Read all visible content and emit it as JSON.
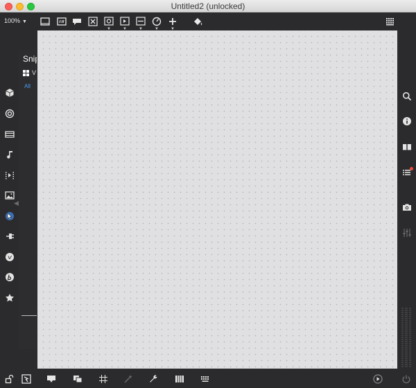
{
  "window": {
    "title": "Untitled2 (unlocked)"
  },
  "toolbar": {
    "zoom_label": "100%",
    "zoom_caret": "▼",
    "icons": [
      "panel-icon",
      "comment-icon",
      "speech-bubble-icon",
      "close-box-icon",
      "target-box-icon",
      "play-box-icon",
      "minus-box-icon",
      "gauge-icon",
      "plus-icon",
      "paint-bucket-icon",
      "keyboard-icon"
    ]
  },
  "left_sidebar": {
    "icons": [
      "package-icon",
      "target-icon",
      "film-icon",
      "music-note-icon",
      "media-sequence-icon",
      "image-icon",
      "cursor-icon",
      "plug-icon",
      "vimeo-icon",
      "b-logo-icon",
      "star-icon"
    ],
    "collapse_arrow": "◀"
  },
  "snippets": {
    "title": "Snip",
    "view_label": "V",
    "filter_all": "All"
  },
  "right_sidebar": {
    "icons": [
      "search-icon",
      "info-icon",
      "book-icon",
      "list-icon",
      "camera-icon",
      "sliders-icon"
    ],
    "notification_color": "#ef4b3c"
  },
  "bottom_bar": {
    "icons": [
      "lock-icon",
      "presentation-icon",
      "slideshow-icon",
      "windows-icon",
      "grid-icon",
      "magic-wand-icon",
      "wrench-icon",
      "piano-icon",
      "keyboard-icon",
      "play-circle-icon",
      "power-icon"
    ]
  },
  "colors": {
    "chrome": "#2b2b2d",
    "canvas": "#e0e0e2",
    "link": "#4a9df6"
  }
}
